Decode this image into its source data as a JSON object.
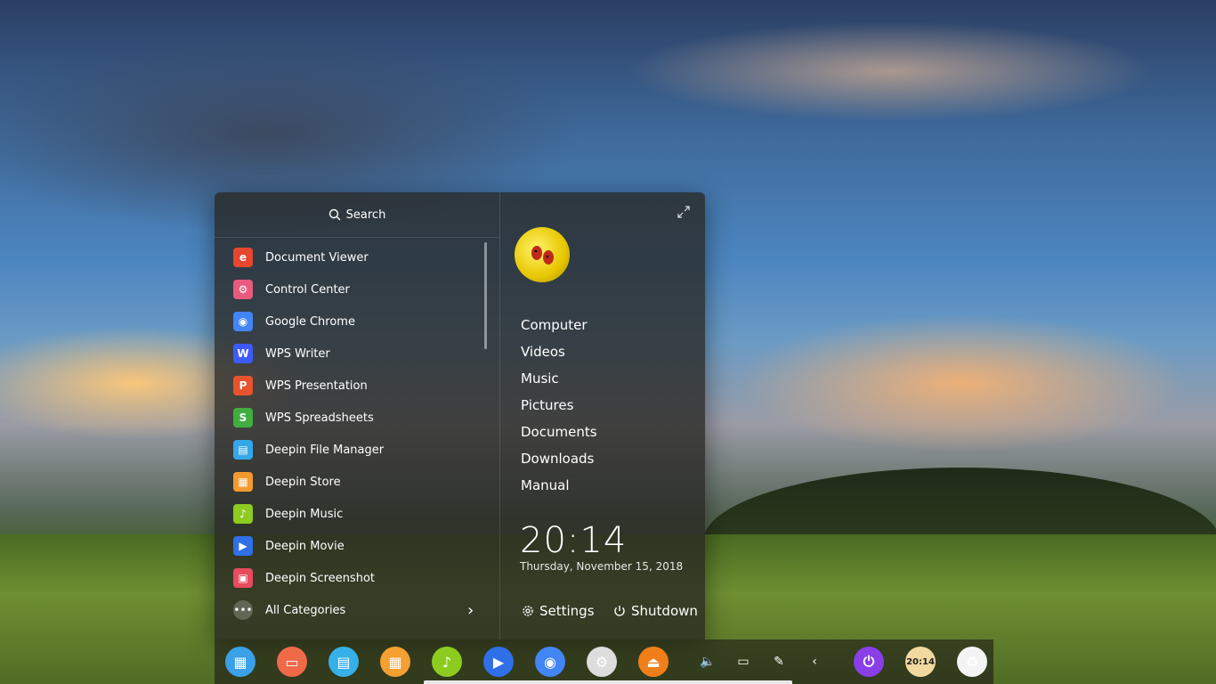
{
  "search": {
    "label": "Search"
  },
  "apps": [
    {
      "label": "Document Viewer",
      "color": "#e8472e",
      "glyph": "e"
    },
    {
      "label": "Control Center",
      "color": "#e85a7e",
      "glyph": "⚙"
    },
    {
      "label": "Google Chrome",
      "color": "#4285f4",
      "glyph": "◉"
    },
    {
      "label": "WPS Writer",
      "color": "#3d5afe",
      "glyph": "W"
    },
    {
      "label": "WPS Presentation",
      "color": "#e8532e",
      "glyph": "P"
    },
    {
      "label": "WPS Spreadsheets",
      "color": "#3fae3f",
      "glyph": "S"
    },
    {
      "label": "Deepin File Manager",
      "color": "#35a7e8",
      "glyph": "▤"
    },
    {
      "label": "Deepin Store",
      "color": "#f29a2e",
      "glyph": "▦"
    },
    {
      "label": "Deepin Music",
      "color": "#8ccc1f",
      "glyph": "♪"
    },
    {
      "label": "Deepin Movie",
      "color": "#2f6fe8",
      "glyph": "▶"
    },
    {
      "label": "Deepin Screenshot",
      "color": "#e84a5e",
      "glyph": "▣"
    }
  ],
  "all_categories": {
    "label": "All Categories"
  },
  "places": [
    "Computer",
    "Videos",
    "Music",
    "Pictures",
    "Documents",
    "Downloads",
    "Manual"
  ],
  "clock": {
    "time": "20:14",
    "date": "Thursday, November 15, 2018"
  },
  "buttons": {
    "settings": "Settings",
    "shutdown": "Shutdown"
  },
  "dock": {
    "apps": [
      {
        "name": "launcher-dock-icon",
        "color": "#3aa0e8",
        "glyph": "▦"
      },
      {
        "name": "multitask-view-dock-icon",
        "color": "#f06a4a",
        "glyph": "▭"
      },
      {
        "name": "file-manager-dock-icon",
        "color": "#35b0e8",
        "glyph": "▤"
      },
      {
        "name": "deepin-store-dock-icon",
        "color": "#f5a030",
        "glyph": "▦"
      },
      {
        "name": "deepin-music-dock-icon",
        "color": "#8ccc1f",
        "glyph": "♪"
      },
      {
        "name": "deepin-movie-dock-icon",
        "color": "#2f6fe8",
        "glyph": "▶"
      },
      {
        "name": "google-chrome-dock-icon",
        "color": "#4285f4",
        "glyph": "◉"
      },
      {
        "name": "control-center-dock-icon",
        "color": "#dddddd",
        "glyph": "⚙"
      },
      {
        "name": "eject-dock-icon",
        "color": "#f07f1a",
        "glyph": "⏏"
      }
    ],
    "tray": [
      {
        "name": "volume-icon",
        "glyph": "🔈"
      },
      {
        "name": "battery-icon",
        "glyph": "▭"
      },
      {
        "name": "pen-icon",
        "glyph": "✎"
      },
      {
        "name": "chevron-left-icon",
        "glyph": "‹"
      }
    ],
    "right": [
      {
        "name": "power-dock-icon",
        "color": "#8a3ee8",
        "glyph": "⏻"
      },
      {
        "name": "clock-dock-icon",
        "color": "#f2d9a0",
        "glyph": "20:14"
      },
      {
        "name": "trash-dock-icon",
        "color": "#f4f4f4",
        "glyph": "♻"
      }
    ]
  }
}
